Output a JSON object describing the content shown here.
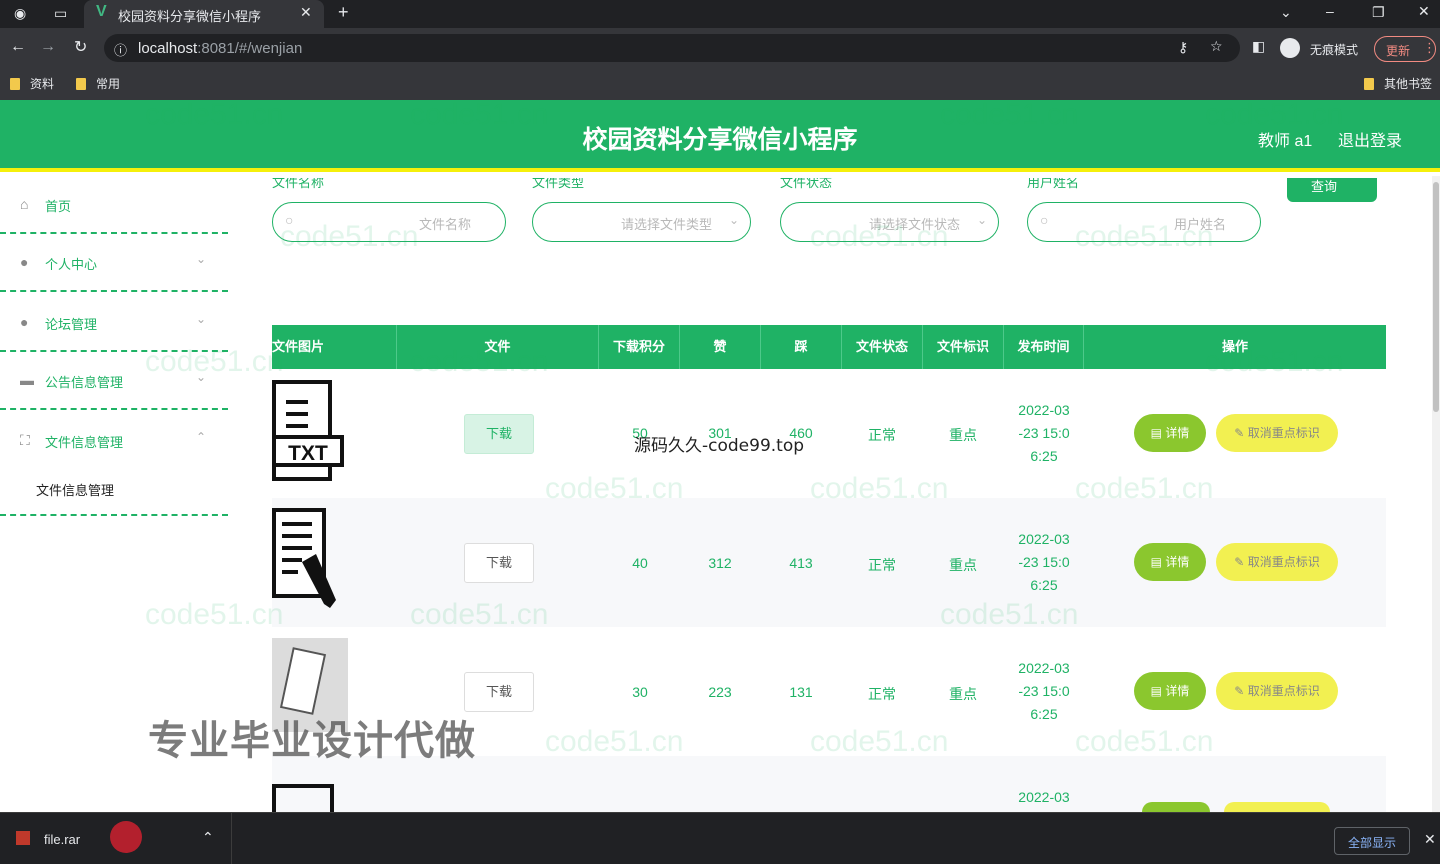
{
  "browser": {
    "tab_title": "校园资料分享微信小程序",
    "url_host": "localhost",
    "url_rest": ":8081/#/wenjian",
    "incognito_label": "无痕模式",
    "update_label": "更新",
    "bookmarks": [
      "资料",
      "常用"
    ],
    "other_bookmarks": "其他书签"
  },
  "header": {
    "title": "校园资料分享微信小程序",
    "user": "教师 a1",
    "logout": "退出登录"
  },
  "sidebar": {
    "items": [
      {
        "label": "首页"
      },
      {
        "label": "个人中心"
      },
      {
        "label": "论坛管理"
      },
      {
        "label": "公告信息管理"
      },
      {
        "label": "文件信息管理"
      }
    ],
    "sub_item": "文件信息管理"
  },
  "filters": {
    "labels": [
      "文件名称",
      "文件类型",
      "文件状态",
      "用户姓名"
    ],
    "name_placeholder": "文件名称",
    "type_placeholder": "请选择文件类型",
    "status_placeholder": "请选择文件状态",
    "user_placeholder": "用户姓名",
    "query": "查询"
  },
  "table": {
    "headers": [
      "文件图片",
      "文件",
      "下载积分",
      "赞",
      "踩",
      "文件状态",
      "文件标识",
      "发布时间",
      "操作"
    ],
    "download_label": "下载",
    "detail_label": "详情",
    "unmark_label": "取消重点标识",
    "rows": [
      {
        "points": "50",
        "likes": "301",
        "dislikes": "460",
        "status": "正常",
        "mark": "重点",
        "time": [
          "2022-03",
          "-23 15:0",
          "6:25"
        ]
      },
      {
        "points": "40",
        "likes": "312",
        "dislikes": "413",
        "status": "正常",
        "mark": "重点",
        "time": [
          "2022-03",
          "-23 15:0",
          "6:25"
        ]
      },
      {
        "points": "30",
        "likes": "223",
        "dislikes": "131",
        "status": "正常",
        "mark": "重点",
        "time": [
          "2022-03",
          "-23 15:0",
          "6:25"
        ]
      },
      {
        "time": [
          "2022-03"
        ]
      }
    ]
  },
  "overlays": {
    "source_watermark": "源码久久-code99.top",
    "promo": "专业毕业设计代做",
    "bg_watermark": "code51.cn"
  },
  "downloads": {
    "file": "file.rar",
    "show_all": "全部显示"
  },
  "colors": {
    "primary": "#1fb265",
    "accent_yellow": "#f5f00b",
    "detail_green": "#8bc72e"
  }
}
